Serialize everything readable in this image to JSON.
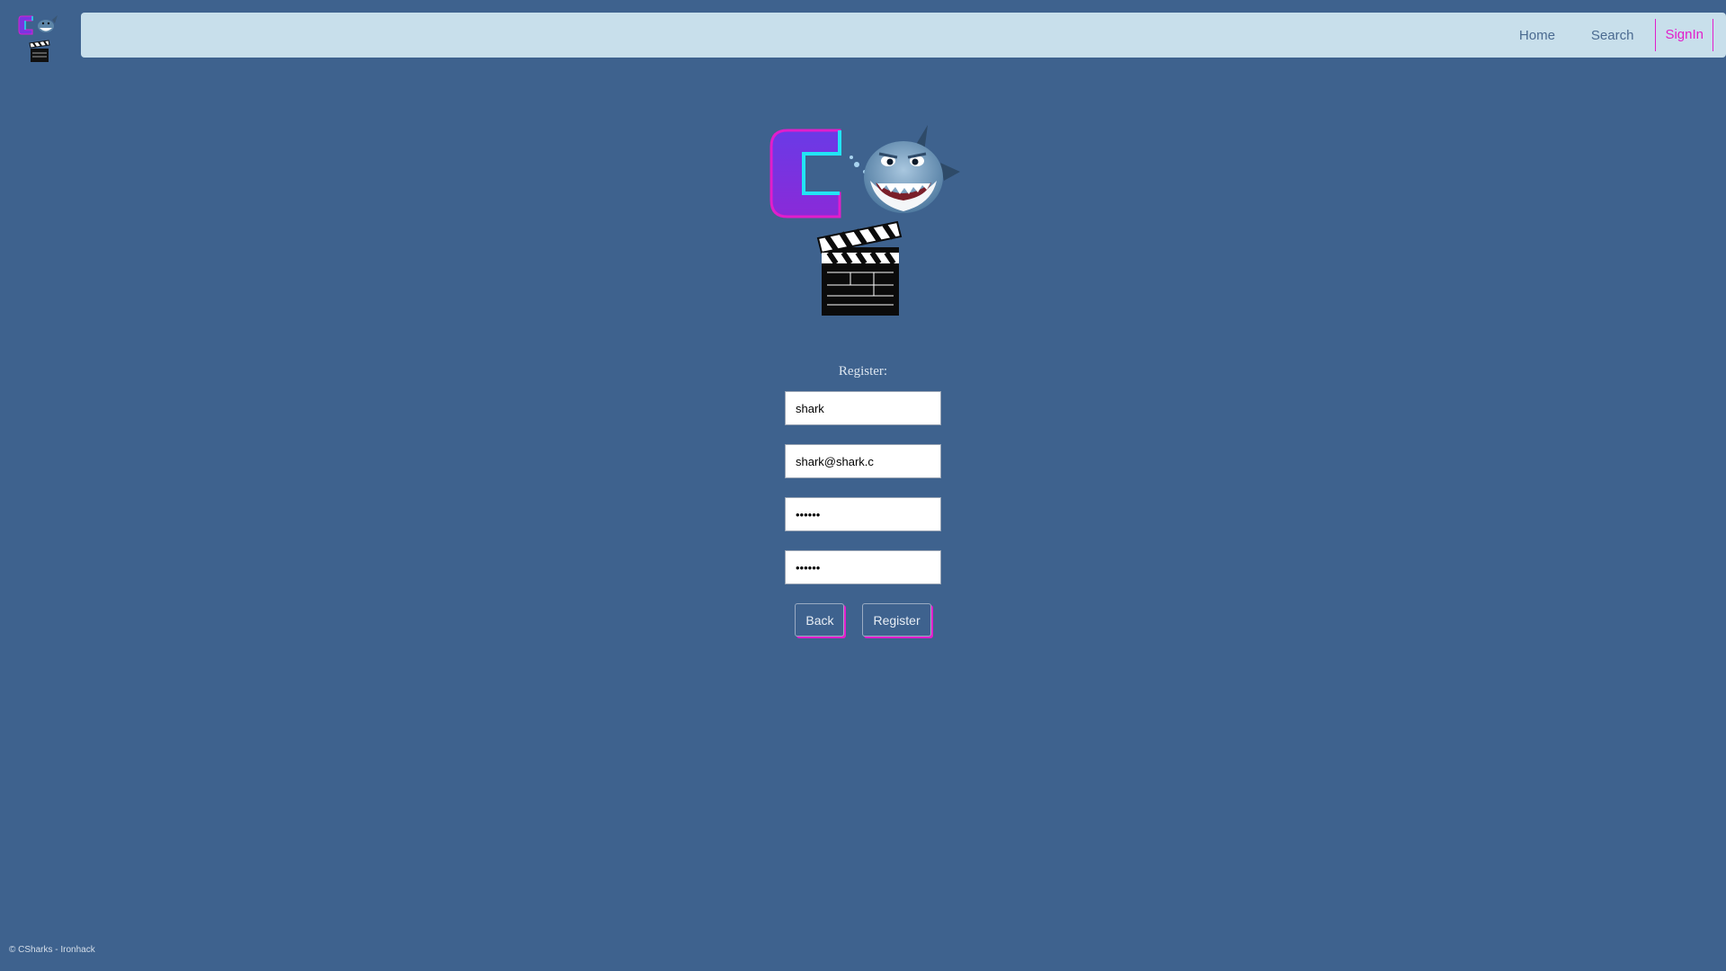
{
  "brand": {
    "logo_icon": "csharks-logo-icon",
    "clapperboard_icon": "clapperboard-icon",
    "colors": {
      "background": "#3e628e",
      "navbar": "#c8dfeb",
      "accent": "#e11ecb",
      "logo_purple": "#7a35e0",
      "logo_cyan": "#20e0f0"
    }
  },
  "nav": {
    "items": [
      {
        "label": "Home"
      },
      {
        "label": "Search"
      },
      {
        "label": "SignIn"
      }
    ],
    "active": "SignIn"
  },
  "form": {
    "title": "Register:",
    "fields": [
      {
        "value": "shark",
        "type": "text"
      },
      {
        "value": "shark@shark.c",
        "type": "text"
      },
      {
        "value": "••••••",
        "type": "password"
      },
      {
        "value": "••••••",
        "type": "password"
      }
    ],
    "buttons": {
      "back_label": "Back",
      "register_label": "Register"
    }
  },
  "footer": {
    "text": "© CSharks - Ironhack"
  }
}
